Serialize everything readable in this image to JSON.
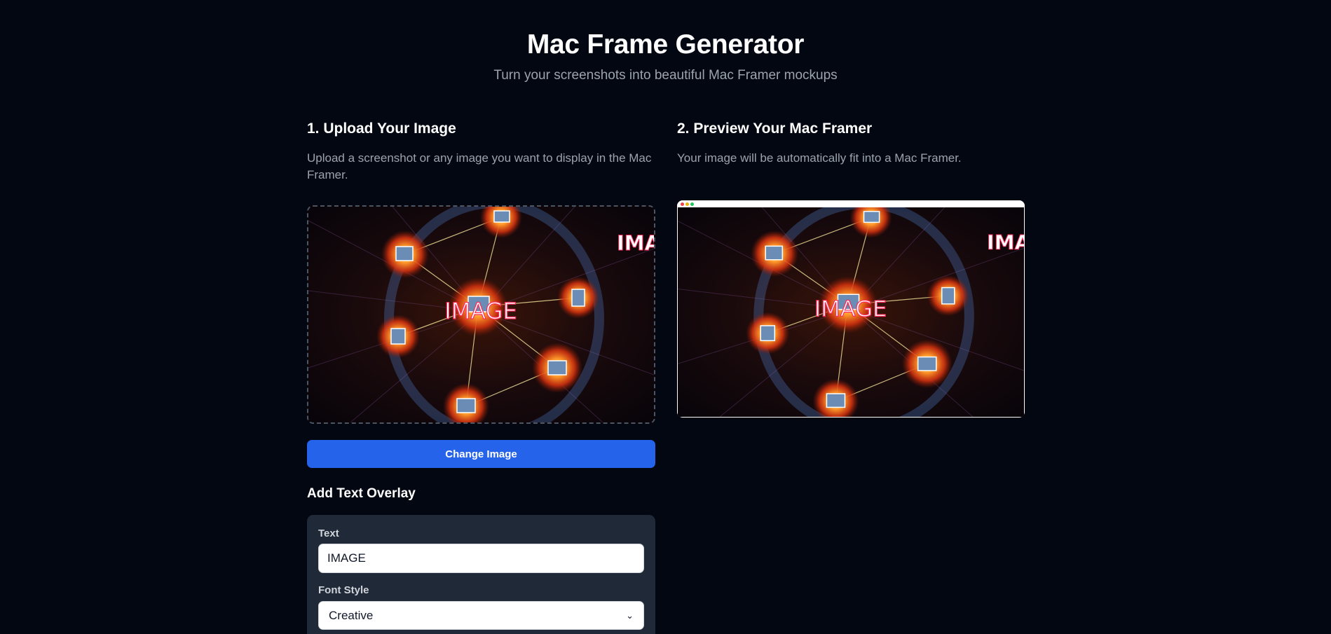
{
  "header": {
    "title": "Mac Frame Generator",
    "subtitle": "Turn your screenshots into beautiful Mac Framer mockups"
  },
  "upload": {
    "title": "1. Upload Your Image",
    "description": "Upload a screenshot or any image you want to display in the Mac Framer.",
    "image_overlay_text": "IMAGE",
    "image_corner_text": "IMA",
    "change_button": "Change Image"
  },
  "preview": {
    "title": "2. Preview Your Mac Framer",
    "description": "Your image will be automatically fit into a Mac Framer.",
    "image_overlay_text": "IMAGE",
    "image_corner_text": "IMA"
  },
  "overlay": {
    "title": "Add Text Overlay",
    "text_label": "Text",
    "text_value": "IMAGE",
    "font_label": "Font Style",
    "font_value": "Creative"
  },
  "colors": {
    "background": "#030712",
    "accent": "#2563eb",
    "panel": "#1f2937",
    "muted_text": "#9ca3af"
  }
}
